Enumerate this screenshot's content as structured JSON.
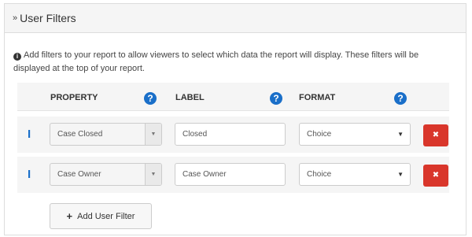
{
  "panel": {
    "chevron": "»",
    "title": "User Filters"
  },
  "info": {
    "icon": "info-circle-icon",
    "text": "Add filters to your report to allow viewers to select which data the report will display. These filters will be displayed at the top of your report."
  },
  "columns": {
    "property": "PROPERTY",
    "label": "LABEL",
    "format": "FORMAT",
    "help_glyph": "?"
  },
  "rows": [
    {
      "property": "Case Closed",
      "label": "Closed",
      "format": "Choice"
    },
    {
      "property": "Case Owner",
      "label": "Case Owner",
      "format": "Choice"
    }
  ],
  "glyphs": {
    "drag": "I",
    "dropdown_caret": "▼",
    "delete": "✖"
  },
  "add_button": {
    "icon": "plus-icon",
    "label": "Add User Filter"
  },
  "colors": {
    "accent_blue": "#1a6fc9",
    "delete_red": "#d9362b"
  }
}
